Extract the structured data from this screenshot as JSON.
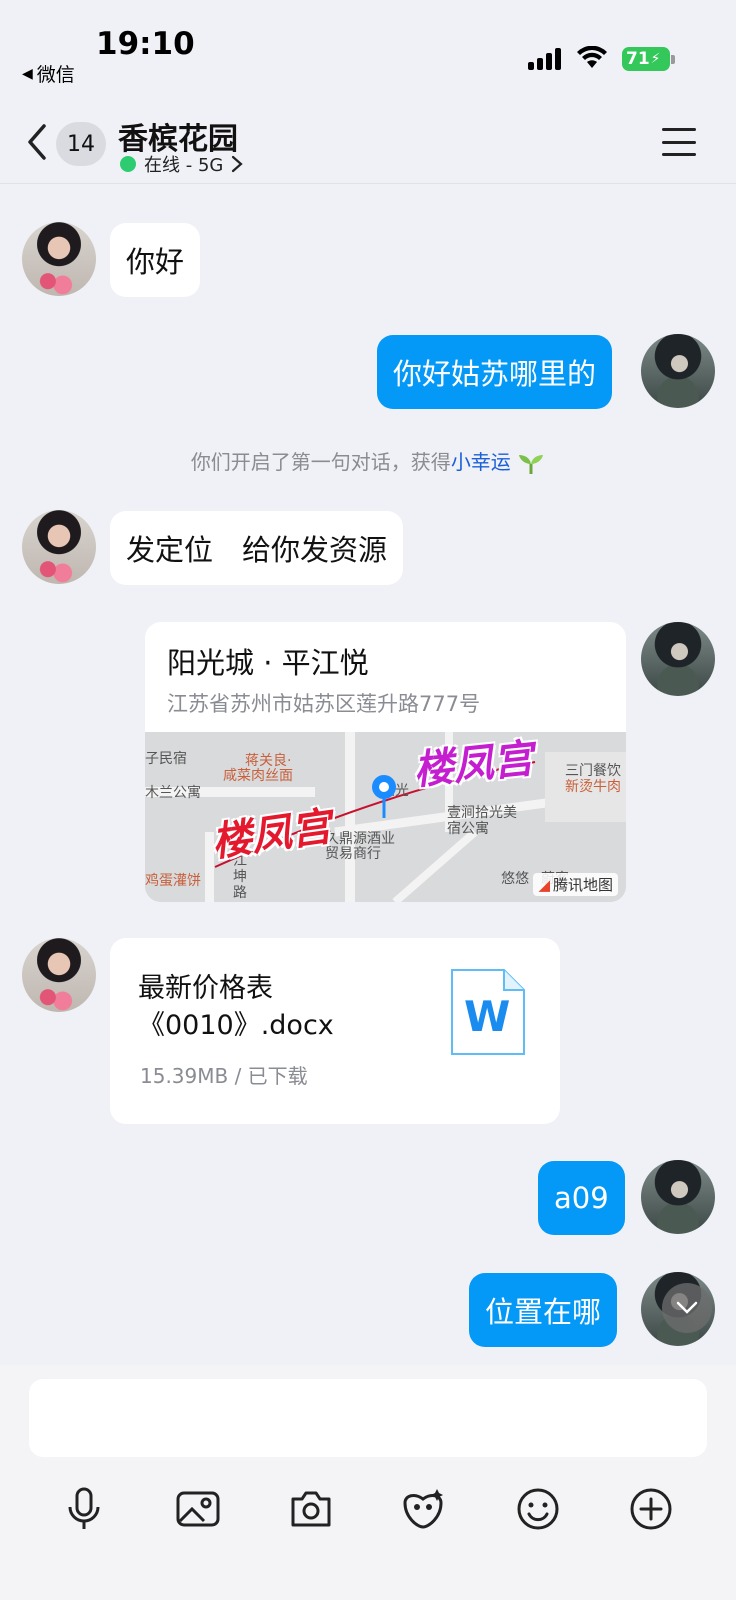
{
  "status_bar": {
    "time": "19:10",
    "back_app_label": "微信",
    "battery_level": "71",
    "icons": [
      "signal-icon",
      "wifi-icon",
      "battery-charging-icon"
    ]
  },
  "header": {
    "unread_count": "14",
    "title": "香槟花园",
    "status_text": "在线 - 5G",
    "status_color": "#2ecc71",
    "icons": [
      "back-chevron-icon",
      "chevron-right-icon",
      "menu-icon"
    ]
  },
  "messages": {
    "msg1": {
      "sender": "contact",
      "text": "你好"
    },
    "msg2": {
      "sender": "me",
      "text": "你好姑苏哪里的"
    },
    "system": {
      "prefix": "你们开启了第一句对话，获得",
      "highlight": "小幸运",
      "icon": "sprout-icon"
    },
    "msg3": {
      "sender": "contact",
      "text": "发定位　给你发资源"
    },
    "location": {
      "sender": "me",
      "title": "阳光城 · 平江悦",
      "address": "江苏省苏州市姑苏区莲升路777号",
      "map_labels": [
        "子民宿",
        "蒋关良·",
        "咸菜肉丝面",
        "木兰公寓",
        "阳光",
        "壹涧拾光美",
        "宿公寓",
        "三门餐饮",
        "新烫牛肉",
        "久鼎源酒业",
        "贸易商行",
        "鸡蛋灌饼",
        "江",
        "坤",
        "路",
        "悠悠",
        "蔚客"
      ],
      "watermark_text": "楼凤宫",
      "provider": "腾讯地图"
    },
    "file": {
      "sender": "contact",
      "name": "最新价格表《0010》.docx",
      "meta": "15.39MB / 已下载",
      "icon_letter": "W"
    },
    "msg4": {
      "sender": "me",
      "text": "a09"
    },
    "msg5": {
      "sender": "me",
      "text": "位置在哪"
    }
  },
  "composer": {
    "input_value": "",
    "tools": [
      "microphone-icon",
      "image-icon",
      "camera-icon",
      "sticker-icon",
      "emoji-icon",
      "plus-icon"
    ]
  },
  "colors": {
    "outgoing_bubble": "#0599f7",
    "incoming_bubble": "#ffffff",
    "background": "#f0f1f6",
    "highlight_link": "#1a5fd8"
  }
}
